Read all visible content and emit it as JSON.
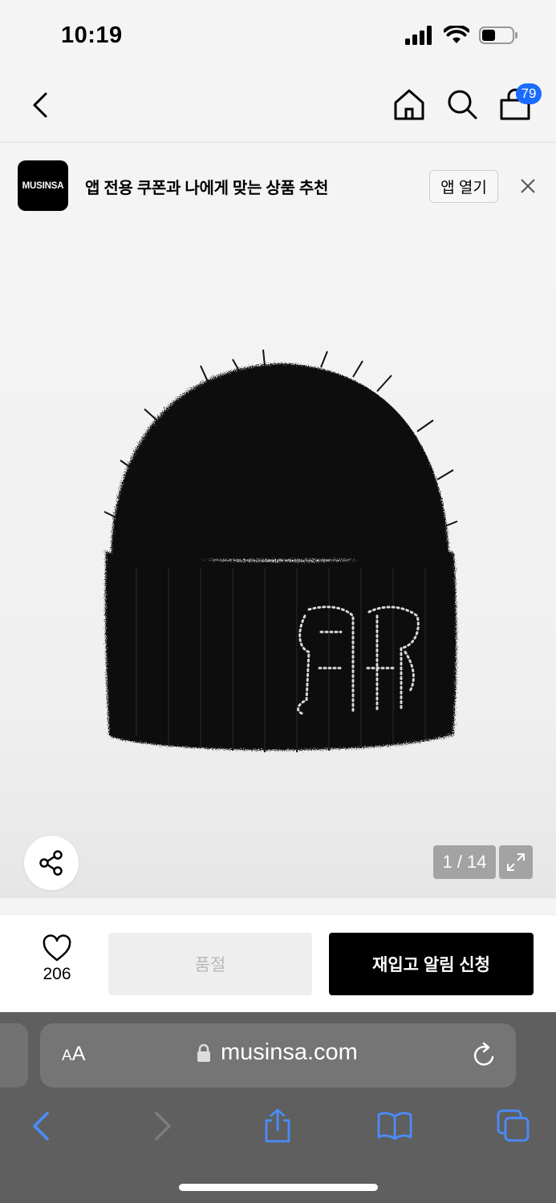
{
  "status_bar": {
    "time": "10:19"
  },
  "nav": {
    "cart_count": "79"
  },
  "promo": {
    "logo_text": "MUSINSA",
    "text": "앱 전용 쿠폰과 나에게 맞는 상품 추천",
    "open_label": "앱 열기"
  },
  "gallery": {
    "counter": "1 / 14"
  },
  "actions": {
    "like_count": "206",
    "soldout_label": "품절",
    "restock_label": "재입고 알림 신청"
  },
  "browser": {
    "aa_small": "A",
    "aa_large": "A",
    "url": "musinsa.com"
  },
  "colors": {
    "badge": "#1a6cff",
    "primary_button": "#000000",
    "disabled_button": "#eeeeee",
    "browser_bar": "#5f5f5f",
    "safari_blue": "#4a8cff"
  }
}
